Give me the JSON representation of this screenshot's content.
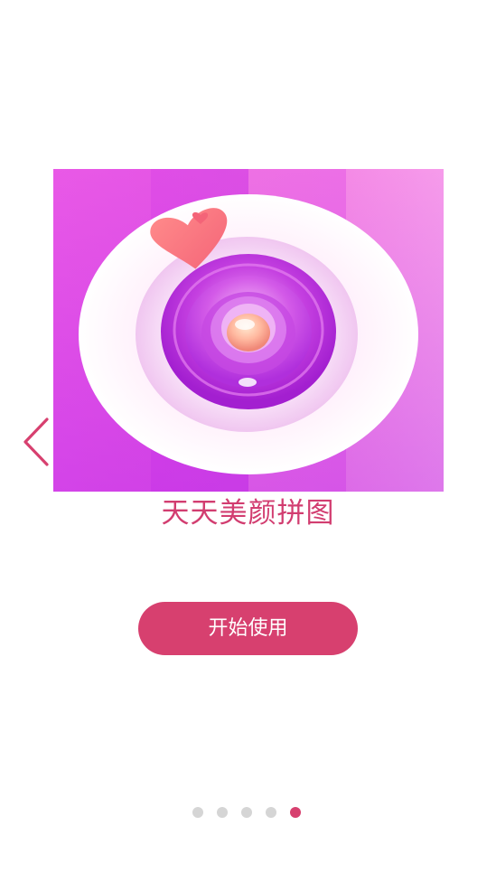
{
  "app": {
    "title": "天天美颜拼图"
  },
  "start_button": {
    "label": "开始使用"
  },
  "pager": {
    "total": 5,
    "active_index": 4
  },
  "colors": {
    "accent": "#d7406f",
    "title": "#d23d70",
    "dot_inactive": "#d5d5d5"
  },
  "icons": {
    "prev": "chevron-left-icon",
    "illustration": "camera-lens-logo"
  }
}
